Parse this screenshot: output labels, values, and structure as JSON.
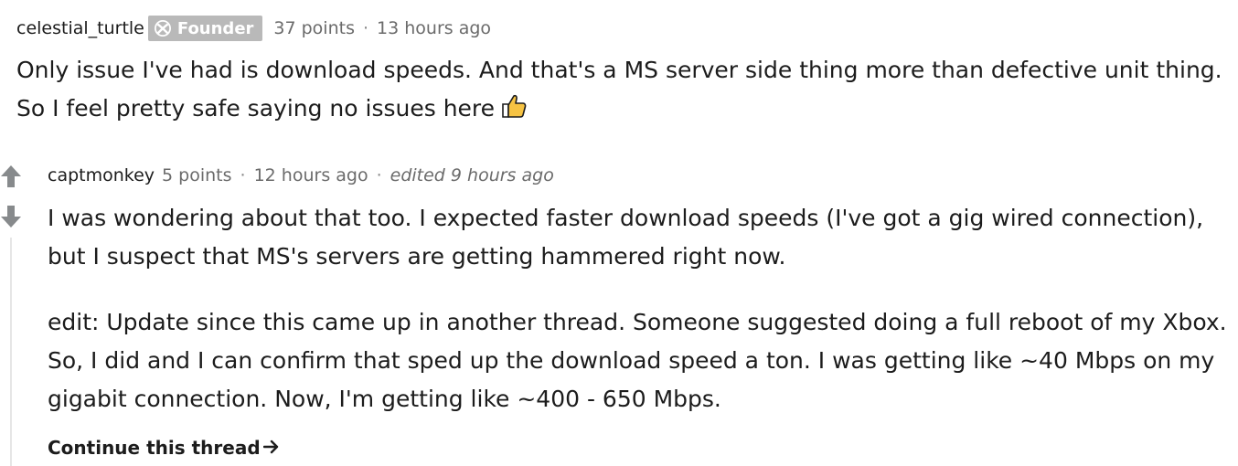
{
  "parent_comment": {
    "username": "celestial_turtle",
    "flair": {
      "label": "Founder",
      "icon": "xbox-logo-icon",
      "bg_color": "#b9b9b9"
    },
    "points": "37 points",
    "time": "13 hours ago",
    "body": "Only issue I've had is download speeds. And that's a MS server side thing more than defective unit thing. So I feel pretty safe saying no issues here",
    "emoji": "thumbs-up-icon"
  },
  "reply": {
    "username": "captmonkey",
    "points": "5 points",
    "time": "12 hours ago",
    "edited": "edited 9 hours ago",
    "body_1": "I was wondering about that too. I expected faster download speeds (I've got a gig wired connection), but I suspect that MS's servers are getting hammered right now.",
    "body_2": "edit: Update since this came up in another thread. Someone suggested doing a full reboot of my Xbox. So, I did and I can confirm that sped up the download speed a ton. I was getting like ~40 Mbps on my gigabit connection. Now, I'm getting like ~400 - 650 Mbps.",
    "continue_label": "Continue this thread",
    "continue_icon": "arrow-right-icon"
  },
  "votes": {
    "upvote_icon": "upvote-arrow-icon",
    "downvote_icon": "downvote-arrow-icon"
  },
  "separator": "·"
}
